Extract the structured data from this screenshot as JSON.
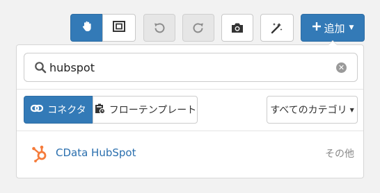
{
  "toolbar": {
    "buttons": {
      "pan_icon": "hand-icon",
      "fit_icon": "fit-frame-icon",
      "undo_icon": "undo-icon",
      "redo_icon": "redo-icon",
      "camera_icon": "camera-icon",
      "magic_icon": "magic-wand-icon"
    },
    "add_label": "追加",
    "accent_color": "#337ab7"
  },
  "search": {
    "value": "hubspot"
  },
  "tabs": [
    {
      "label": "コネクタ",
      "icon": "connector-icon",
      "active": true
    },
    {
      "label": "フローテンプレート",
      "icon": "template-icon",
      "active": false
    }
  ],
  "category": {
    "selected": "すべてのカテゴリ"
  },
  "results": [
    {
      "name": "CData HubSpot",
      "category": "その他",
      "icon": "hubspot-icon",
      "icon_color": "#f57b3a"
    }
  ]
}
